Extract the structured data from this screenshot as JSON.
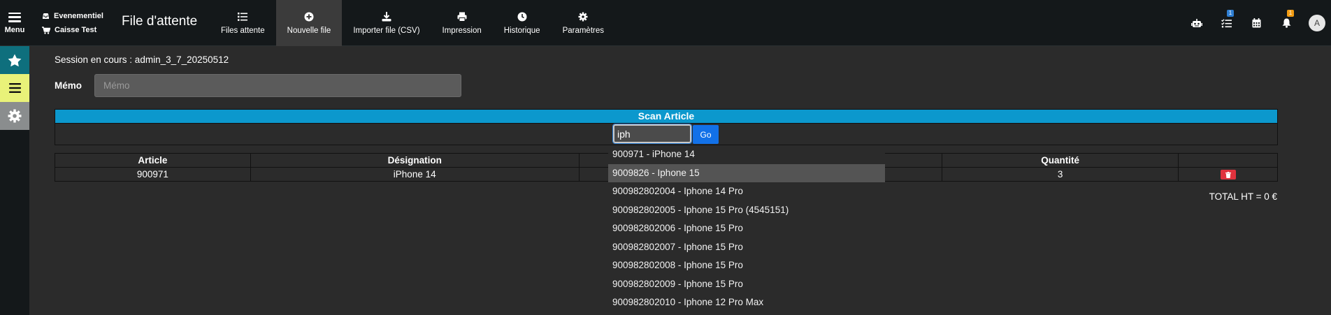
{
  "header": {
    "menu_label": "Menu",
    "shop_name": "Evenementiel",
    "register_name": "Caisse Test",
    "title": "File d'attente",
    "tabs": [
      {
        "label": "Files attente",
        "icon": "list-icon"
      },
      {
        "label": "Nouvelle file",
        "icon": "plus-circle-icon",
        "active": true
      },
      {
        "label": "Importer file (CSV)",
        "icon": "download-icon"
      },
      {
        "label": "Impression",
        "icon": "printer-icon"
      },
      {
        "label": "Historique",
        "icon": "clock-icon"
      },
      {
        "label": "Paramètres",
        "icon": "gear-icon"
      }
    ],
    "right_icons": [
      {
        "name": "robot-icon"
      },
      {
        "name": "checklist-icon",
        "badge": "1",
        "badge_color": "#2f7fd3"
      },
      {
        "name": "calendar-icon"
      },
      {
        "name": "bell-icon",
        "badge": "1",
        "badge_color": "#f39c12"
      }
    ],
    "avatar_initial": "A"
  },
  "sidebar": {
    "items": [
      {
        "icon": "star-icon",
        "color": "#0e6f7d"
      },
      {
        "icon": "hamburger-icon",
        "color": "#e9f279"
      },
      {
        "icon": "gear-icon",
        "color": "#8a8d8e"
      }
    ]
  },
  "session": {
    "text": "Session en cours : admin_3_7_20250512"
  },
  "memo": {
    "label": "Mémo",
    "placeholder": "Mémo",
    "value": ""
  },
  "scan": {
    "title": "Scan Article",
    "input_value": "iph",
    "go_label": "Go"
  },
  "table": {
    "headers": [
      "Article",
      "Désignation",
      "",
      "Quantité",
      ""
    ],
    "rows": [
      {
        "article": "900971",
        "designation": "iPhone 14",
        "quantity": "3"
      }
    ]
  },
  "total": {
    "text": "TOTAL HT = 0 €"
  },
  "suggestions": {
    "highlighted_index": 1,
    "items": [
      "900971 - iPhone 14",
      "9009826 - Iphone 15",
      "900982802004 - Iphone 14 Pro",
      "900982802005 - Iphone 15 Pro (4545151)",
      "900982802006 - Iphone 15 Pro",
      "900982802007 - Iphone 15 Pro",
      "900982802008 - Iphone 15 Pro",
      "900982802009 - Iphone 15 Pro",
      "900982802010 - Iphone 12 Pro Max"
    ]
  },
  "colors": {
    "topbar": "#14181a",
    "scan_header": "#0c98cd",
    "go_button": "#1271e8",
    "delete_button": "#e0323d"
  }
}
